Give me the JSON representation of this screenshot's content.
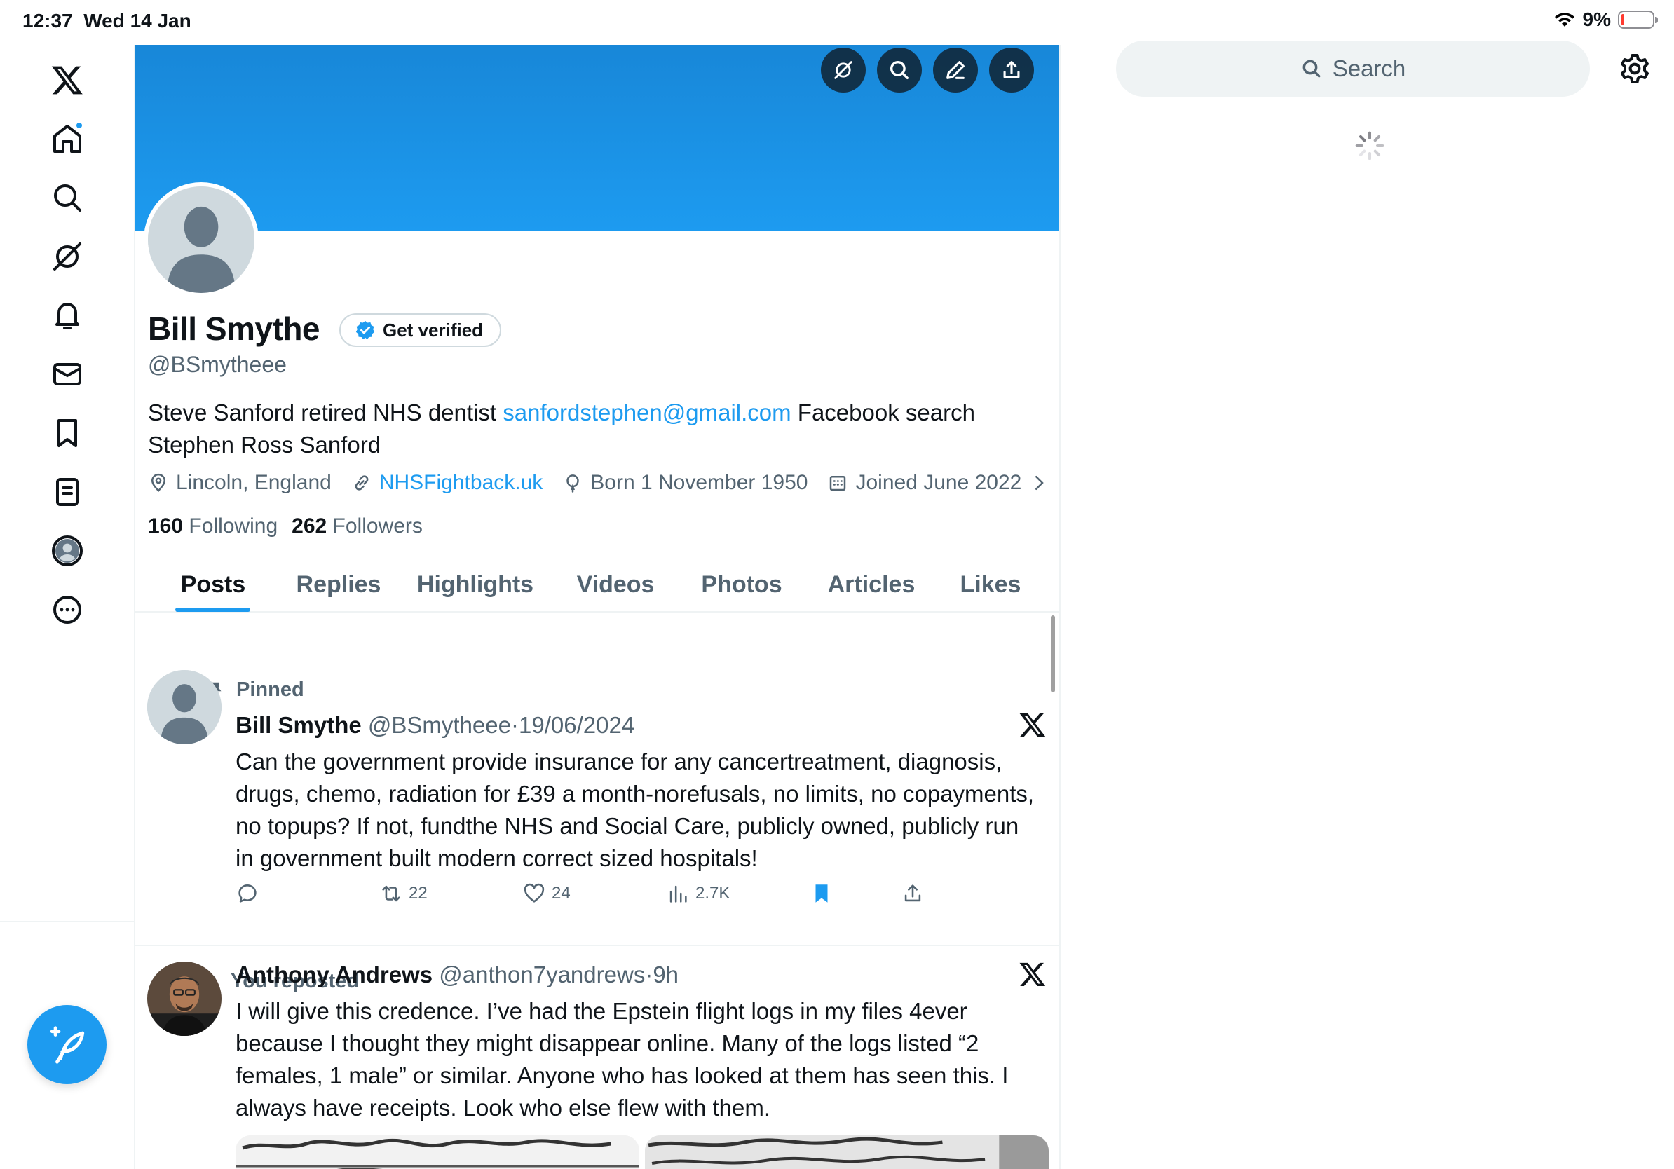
{
  "status": {
    "time": "12:37",
    "date": "Wed 14 Jan",
    "battery": "9%",
    "battery_level": 0.09
  },
  "nav": {
    "items": [
      "X logo",
      "Home",
      "Search",
      "Grok",
      "Notifications",
      "Messages",
      "Bookmarks",
      "Lists",
      "Profile",
      "More"
    ],
    "post_button": "compose-post"
  },
  "profile": {
    "name": "Bill Smythe",
    "verify_label": "Get verified",
    "handle": "@BSmytheee",
    "bio_part1": "Steve Sanford retired NHS dentist ",
    "bio_link": "sanfordstephen@gmail.com",
    "bio_part2": " Facebook search Stephen Ross Sanford",
    "location": "Lincoln, England",
    "website": "NHSFightback.uk",
    "born": "Born 1 November 1950",
    "joined": "Joined June 2022",
    "following_count": "160",
    "following_label": "Following",
    "followers_count": "262",
    "followers_label": "Followers"
  },
  "tabs": [
    "Posts",
    "Replies",
    "Highlights",
    "Videos",
    "Photos",
    "Articles",
    "Likes"
  ],
  "active_tab": "Posts",
  "posts": [
    {
      "label": "Pinned",
      "name": "Bill Smythe",
      "handle": "@BSmytheee",
      "sep": "·",
      "time": "19/06/2024",
      "text": "Can the government provide insurance for any cancertreatment, diagnosis, drugs, chemo, radiation for £39 a month-norefusals, no limits, no copayments,  no topups? If not, fundthe NHS and Social Care, publicly owned, publicly run in government built modern correct sized hospitals!",
      "retweets": "22",
      "likes": "24",
      "views": "2.7K"
    },
    {
      "label": "You reposted",
      "name": "Anthony Andrews",
      "handle": "@anthon7yandrews",
      "sep": "·",
      "time": "9h",
      "text": "I will give this credence. I’ve had the Epstein flight logs in my files 4ever because I thought they might disappear online. Many of the logs listed “2 females, 1 male” or similar. Anyone who has looked at them has seen this. I always have receipts. Look who else flew with them."
    }
  ],
  "right": {
    "search_placeholder": "Search"
  },
  "colors": {
    "accent": "#1d9bf0",
    "text": "#0f1419",
    "muted": "#536471",
    "border": "#eff3f4"
  }
}
